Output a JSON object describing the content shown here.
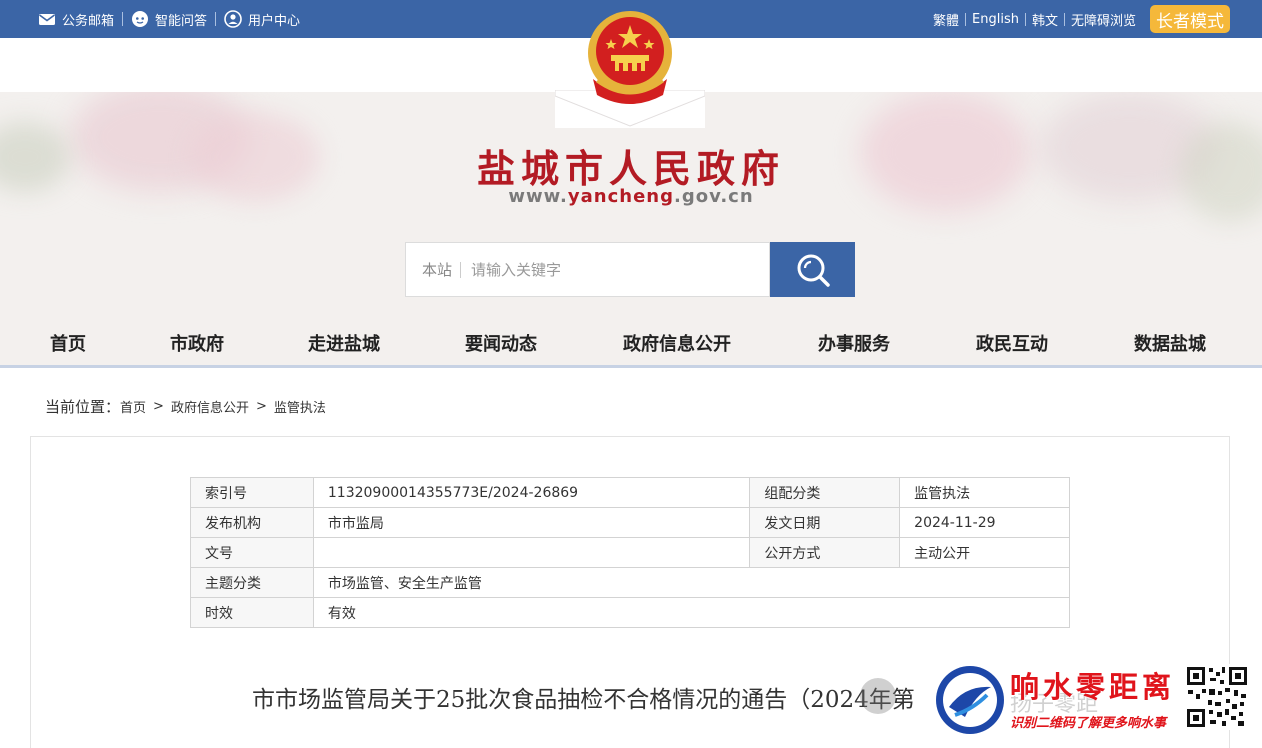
{
  "topbar": {
    "mail": "公务邮箱",
    "qa": "智能问答",
    "user": "用户中心",
    "traditional": "繁體",
    "english": "English",
    "korean": "韩文",
    "accessible": "无障碍浏览",
    "elder_mode": "长者模式",
    "bg_color": "#3b65a6",
    "elder_color": "#f5b83a"
  },
  "header": {
    "title": "盐城市人民政府",
    "url_prefix": "www.",
    "url_highlight": "yancheng",
    "url_suffix": ".gov.cn",
    "emblem_icon": "national-emblem",
    "title_color": "#b31b24"
  },
  "search": {
    "scope": "本站",
    "placeholder": "请输入关键字",
    "button_icon": "search-icon"
  },
  "nav": {
    "items": [
      "首页",
      "市政府",
      "走进盐城",
      "要闻动态",
      "政府信息公开",
      "办事服务",
      "政民互动",
      "数据盐城"
    ]
  },
  "breadcrumb": {
    "lead": "当前位置：",
    "items": [
      "首页",
      "政府信息公开",
      "监管执法"
    ],
    "separator": ">"
  },
  "meta": {
    "index_label": "索引号",
    "index_value": "11320900014355773E/2024-26869",
    "category_label": "组配分类",
    "category_value": "监管执法",
    "org_label": "发布机构",
    "org_value": "市市监局",
    "date_label": "发文日期",
    "date_value": "2024-11-29",
    "docno_label": "文号",
    "docno_value": "",
    "publicity_label": "公开方式",
    "publicity_value": "主动公开",
    "topic_label": "主题分类",
    "topic_value": "市场监管、安全生产监管",
    "validity_label": "时效",
    "validity_value": "有效"
  },
  "doc": {
    "title": "市市场监管局关于25批次食品抽检不合格情况的通告（2024年第"
  },
  "watermark": {
    "faint_text": "扬子零距",
    "name": "响水零距离",
    "tip": "识别二维码了解更多响水事",
    "color": "#e0141b"
  }
}
